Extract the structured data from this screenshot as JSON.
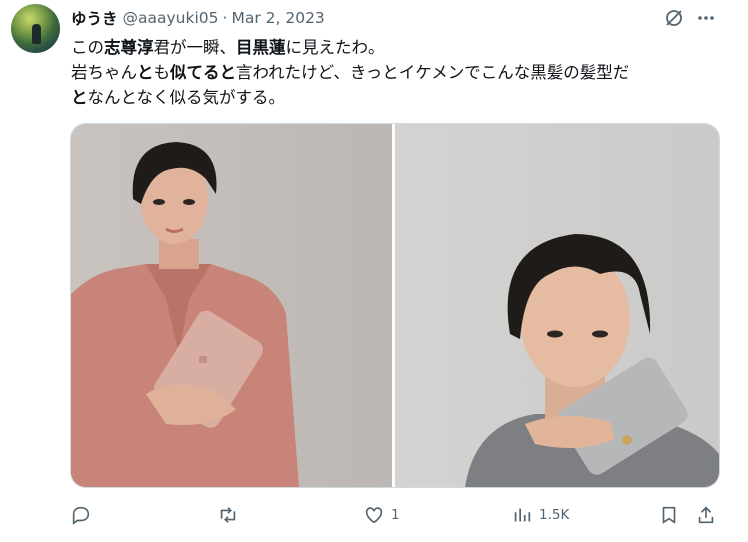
{
  "tweet": {
    "author": {
      "display_name": "ゆうき",
      "handle": "@aaayuki05",
      "separator": "·",
      "date": "Mar 2, 2023"
    },
    "text_lines": [
      [
        {
          "t": "この",
          "b": false
        },
        {
          "t": "志尊淳",
          "b": true
        },
        {
          "t": "君が一瞬、",
          "b": false
        },
        {
          "t": "目黒蓮",
          "b": true
        },
        {
          "t": "に見えたわ。",
          "b": false
        }
      ],
      [
        {
          "t": "岩ちゃん",
          "b": false
        },
        {
          "t": "と",
          "b": true
        },
        {
          "t": "も",
          "b": false
        },
        {
          "t": "似てると",
          "b": true
        },
        {
          "t": "言われたけど、きっとイケメンでこんな黒髪の髪型だ",
          "b": false
        }
      ],
      [
        {
          "t": "と",
          "b": true
        },
        {
          "t": "なんとなく似る気がする。",
          "b": false
        }
      ]
    ],
    "media": [
      {
        "description": "man-pink-shirt-holding-pink-wallet"
      },
      {
        "description": "man-grey-sweater-holding-grey-wallet"
      }
    ],
    "actions": {
      "reply": {
        "icon": "reply-icon",
        "count": ""
      },
      "retweet": {
        "icon": "retweet-icon",
        "count": ""
      },
      "like": {
        "icon": "heart-icon",
        "count": "1"
      },
      "views": {
        "icon": "views-icon",
        "count": "1.5K"
      },
      "bookmark": {
        "icon": "bookmark-icon",
        "count": ""
      },
      "share": {
        "icon": "share-icon",
        "count": ""
      }
    },
    "top_icons": [
      "grok-icon",
      "more-icon"
    ]
  },
  "colors": {
    "text": "#0f1419",
    "secondary": "#536471",
    "border": "#cfd9de",
    "background": "#ffffff"
  }
}
